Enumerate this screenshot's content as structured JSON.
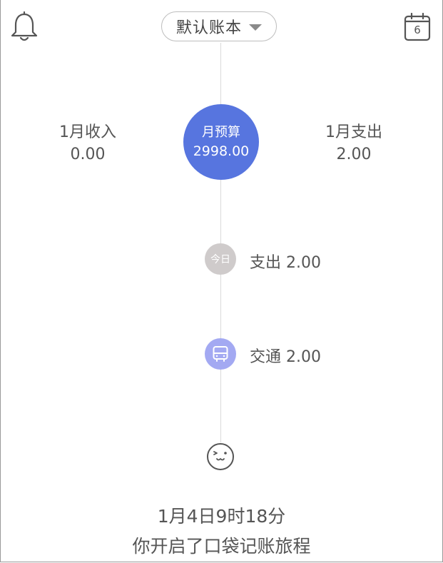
{
  "header": {
    "book_name": "默认账本",
    "calendar_day": "6",
    "bell_icon": "bell-icon",
    "calendar_icon": "calendar-icon"
  },
  "summary": {
    "income_label": "1月收入",
    "income_value": "0.00",
    "budget_label": "月预算",
    "budget_value": "2998.00",
    "expense_label": "1月支出",
    "expense_value": "2.00"
  },
  "timeline": {
    "today_badge": "今日",
    "today_entry": "支出 2.00",
    "transport_entry": "交通 2.00",
    "transport_icon": "bus-icon",
    "start_icon": "smile-face-icon",
    "start_time": "1月4日9时18分",
    "start_message": "你开启了口袋记账旅程"
  },
  "colors": {
    "budget_circle": "#5775df",
    "transport_node": "#a3a9f2",
    "today_node": "#cfcbcb",
    "text": "#555555"
  }
}
